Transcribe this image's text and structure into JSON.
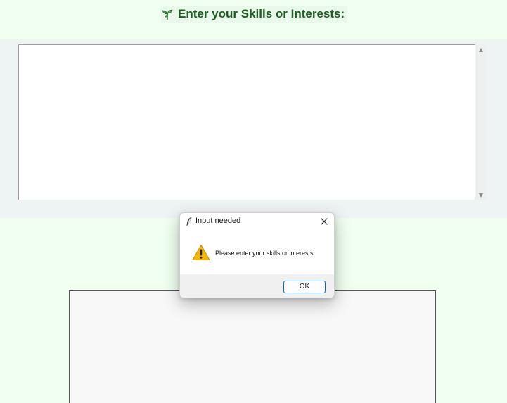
{
  "header": {
    "title": "Enter your Skills or Interests:",
    "icon": "sprout-icon"
  },
  "skills_input": {
    "value": ""
  },
  "dialog": {
    "title": "Input needed",
    "message": "Please enter your skills or interests.",
    "ok_label": "OK",
    "icon": "warning-icon"
  },
  "colors": {
    "background": "#f0fff0",
    "title_text": "#1b5e20",
    "accent_button_border": "#0067c0",
    "warning_yellow": "#f5b800"
  }
}
